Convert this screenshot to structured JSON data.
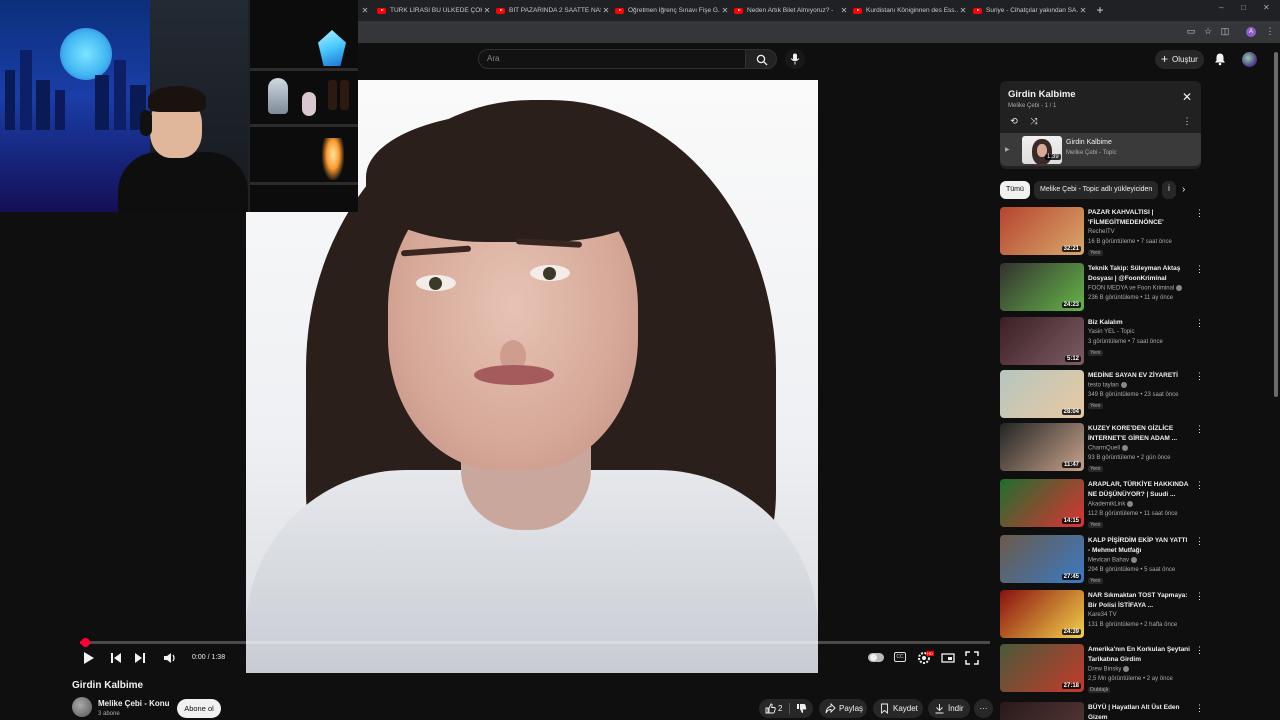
{
  "browser": {
    "tabs": [
      {
        "label": "TÜRK LİRASI BU ÜLKEDE ÇOK D..."
      },
      {
        "label": "BİT PAZARINDA 2 SAATTE NAS..."
      },
      {
        "label": "Öğretmen İğrenç Sınavı Fişe G..."
      },
      {
        "label": "Neden Artık Bilet Almıyoruz? -"
      },
      {
        "label": "Kurdistanı Königinnen des Ess..."
      },
      {
        "label": "Suriye - Cihatçılar yakından SA..."
      }
    ],
    "new_tab": "+",
    "profile_letter": "A"
  },
  "header": {
    "search_placeholder": "Ara",
    "create_label": "Oluştur"
  },
  "player": {
    "time": "0:00 / 1:38",
    "progress_fraction": 0.005,
    "cc": "CC",
    "hd": "HD"
  },
  "video": {
    "title": "Girdin Kalbime",
    "channel": "Melike Çebi - Konu",
    "subscribers": "3 abone",
    "subscribe_label": "Abone ol",
    "likes": "2",
    "share_label": "Paylaş",
    "save_label": "Kaydet",
    "download_label": "İndir",
    "more_label": "···"
  },
  "playlist": {
    "title": "Girdin Kalbime",
    "subtitle": "Melike Çebi - 1 / 1",
    "item_title": "Girdin Kalbime",
    "item_channel": "Melike Çebi - Topic",
    "item_duration": "1:39"
  },
  "chips": [
    {
      "label": "Tümü",
      "active": true
    },
    {
      "label": "Melike Çebi - Topic adlı yükleyiciden",
      "active": false
    },
    {
      "label": "İ",
      "active": false
    }
  ],
  "recommendations": [
    {
      "title": "PAZAR KAHVALTISI | 'FİLMEGİTMEDENÖNCE'",
      "channel": "RecheITV",
      "meta": "16 B görüntüleme • 7 saat önce",
      "badge": "Yeni",
      "duration": "32:21",
      "verified": false,
      "color": "#b5442f",
      "color2": "#d9a86a"
    },
    {
      "title": "Teknik Takip: Süleyman Aktaş Dosyası | @FoonKriminal",
      "channel": "FOON MEDYA ve Foon Kriminal",
      "meta": "236 B görüntüleme • 11 ay önce",
      "badge": "",
      "duration": "24:23",
      "verified": true,
      "color": "#33322f",
      "color2": "#66b54a"
    },
    {
      "title": "Biz Kalalım",
      "channel": "Yasin YEL - Topic",
      "meta": "3 görüntüleme • 7 saat önce",
      "badge": "Yeni",
      "duration": "5:12",
      "verified": false,
      "color": "#3a1f24",
      "color2": "#7d5c63"
    },
    {
      "title": "MEDİNE SAYAN EV ZİYARETİ",
      "channel": "testo taylan",
      "meta": "349 B görüntüleme • 23 saat önce",
      "badge": "Yeni",
      "duration": "28:04",
      "verified": true,
      "color": "#b6c6c0",
      "color2": "#e8c9a0"
    },
    {
      "title": "KUZEY KORE'DEN GİZLİCE İNTERNET'E GİREN ADAM ...",
      "channel": "CharmQuell",
      "meta": "93 B görüntüleme • 2 gün önce",
      "badge": "Yeni",
      "duration": "11:47",
      "verified": true,
      "color": "#242424",
      "color2": "#c7a38b"
    },
    {
      "title": "ARAPLAR, TÜRKİYE HAKKINDA NE DÜŞÜNÜYOR? | Suudi ...",
      "channel": "AkademikLink",
      "meta": "112 B görüntüleme • 11 saat önce",
      "badge": "Yeni",
      "duration": "14:15",
      "verified": true,
      "color": "#1f6e2e",
      "color2": "#d33"
    },
    {
      "title": "KALP PİŞİRDİM EKİP YAN YATTI - Mehmet Mutfağı",
      "channel": "Mevlcan Bahav",
      "meta": "294 B görüntüleme • 5 saat önce",
      "badge": "Yeni",
      "duration": "27:45",
      "verified": true,
      "color": "#6b5a4a",
      "color2": "#3a7ac4"
    },
    {
      "title": "NAR Sıkmaktan TOST Yapmaya: Bir Polisi İSTİFAYA ...",
      "channel": "Kare34 TV",
      "meta": "131 B görüntüleme • 2 hafta önce",
      "badge": "",
      "duration": "24:39",
      "verified": false,
      "color": "#8a1010",
      "color2": "#f2d24a"
    },
    {
      "title": "Amerika'nın En Korkulan Şeytani Tarikatına Girdim",
      "channel": "Drew Binsky",
      "meta": "2,5 Mn görüntüleme • 2 ay önce",
      "badge": "Dublajlı",
      "duration": "27:18",
      "verified": true,
      "color": "#4a5a3a",
      "color2": "#c43a2a"
    },
    {
      "title": "BÜYÜ | Hayatları Alt Üst Eden Gizem",
      "channel": "",
      "meta": "",
      "badge": "",
      "duration": "",
      "verified": false,
      "color": "#2a1a1a",
      "color2": "#5a3a3a"
    }
  ],
  "colors": {
    "background": "#0f0f0f",
    "accent": "#ff0033",
    "surface": "#272727"
  }
}
